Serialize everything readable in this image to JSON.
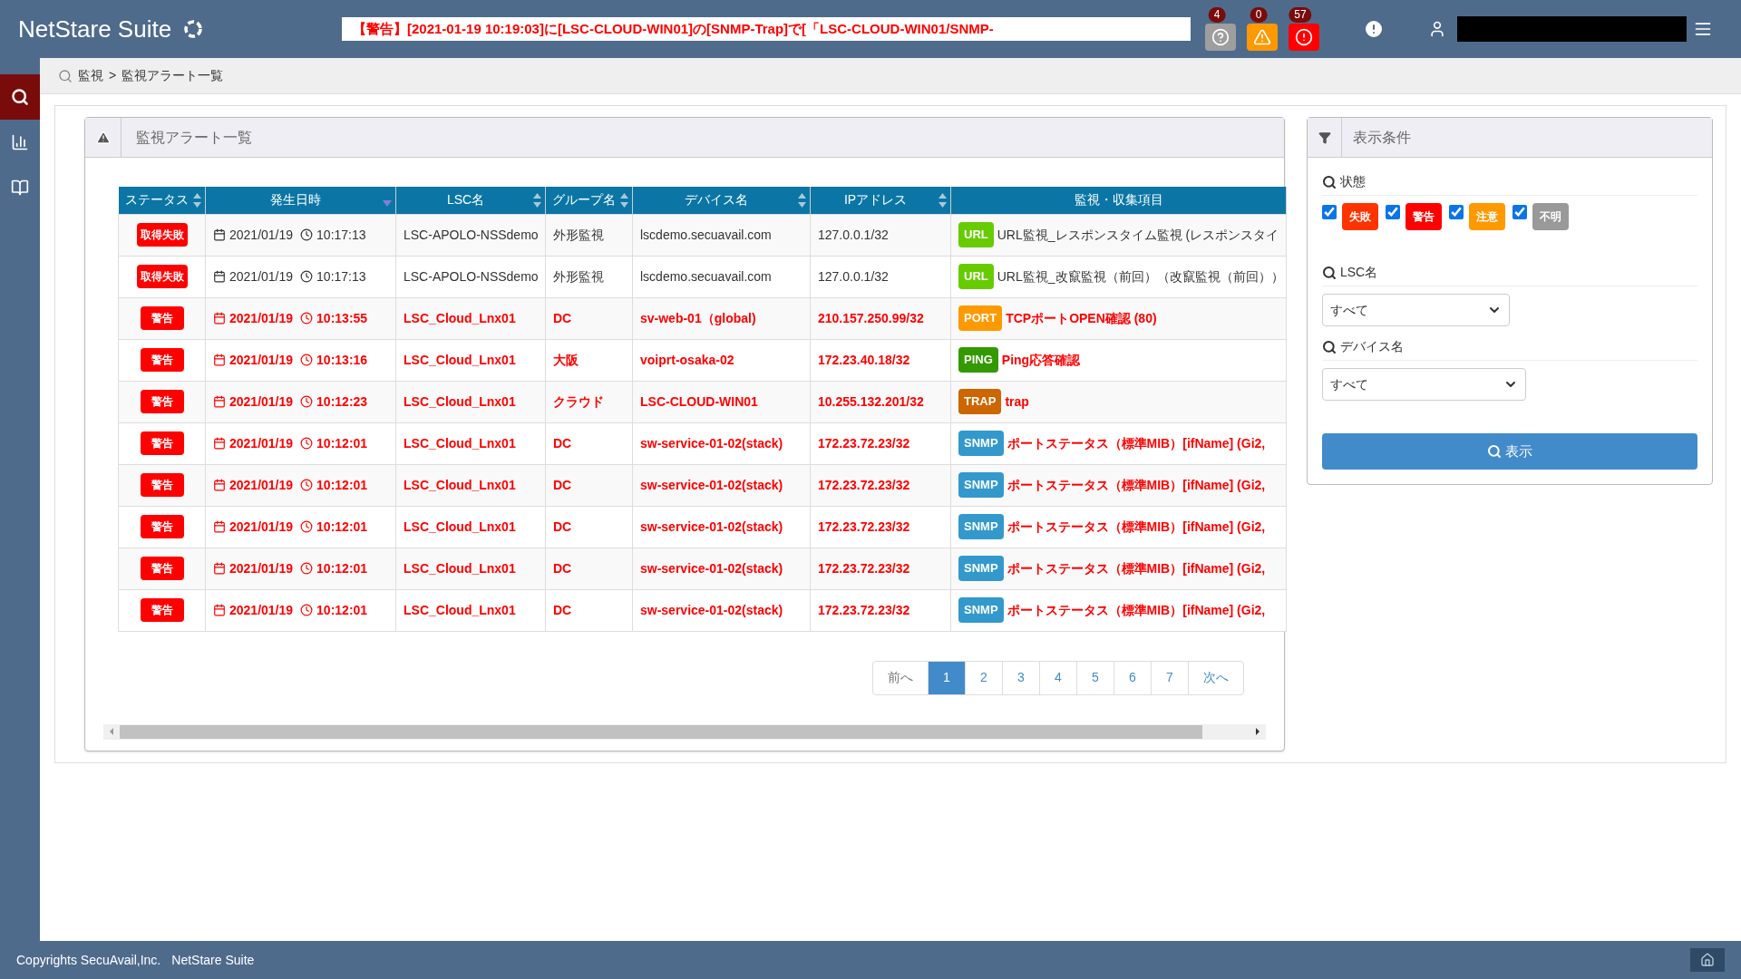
{
  "header": {
    "logo": "NetStare Suite",
    "alert_ticker": "【警告】[2021-01-19 10:19:03]に[LSC-CLOUD-WIN01]の[SNMP-Trap]で[「LSC-CLOUD-WIN01/SNMP-",
    "counters": [
      {
        "kind": "unknown",
        "count": "4"
      },
      {
        "kind": "caution",
        "count": "0"
      },
      {
        "kind": "warning",
        "count": "57"
      }
    ]
  },
  "sidebar": {
    "items": [
      {
        "kind": "search",
        "selected": true
      },
      {
        "kind": "chart",
        "selected": false
      },
      {
        "kind": "book",
        "selected": false
      }
    ]
  },
  "breadcrumb": {
    "items": [
      "監視",
      "監視アラート一覧"
    ],
    "separator": ">"
  },
  "alert_panel": {
    "title": "監視アラート一覧",
    "columns": [
      {
        "label": "ステータス",
        "kind": "sortable"
      },
      {
        "label": "発生日時",
        "kind": "sorted"
      },
      {
        "label": "LSC名",
        "kind": "sortable"
      },
      {
        "label": "グループ名",
        "kind": "sortable"
      },
      {
        "label": "デバイス名",
        "kind": "sortable"
      },
      {
        "label": "IPアドレス",
        "kind": "sortable"
      },
      {
        "label": "監視・収集項目",
        "kind": "plain"
      }
    ],
    "rows": [
      {
        "status": {
          "label": "取得失敗",
          "kind": "failed"
        },
        "date": "2021/01/19",
        "time": "10:17:13",
        "lsc": "LSC-APOLO-NSSdemo",
        "group": "外形監視",
        "device": "lscdemo.secuavail.com",
        "ip": "127.0.0.1/32",
        "item_type": {
          "label": "URL",
          "color": "#66cc00"
        },
        "item": "URL監視_レスポンスタイム監視 (レスポンスタイ"
      },
      {
        "status": {
          "label": "取得失敗",
          "kind": "failed"
        },
        "date": "2021/01/19",
        "time": "10:17:13",
        "lsc": "LSC-APOLO-NSSdemo",
        "group": "外形監視",
        "device": "lscdemo.secuavail.com",
        "ip": "127.0.0.1/32",
        "item_type": {
          "label": "URL",
          "color": "#66cc00"
        },
        "item": "URL監視_改竄監視（前回）（改竄監視（前回））"
      },
      {
        "status": {
          "label": "警告",
          "kind": "warning"
        },
        "date": "2021/01/19",
        "time": "10:13:55",
        "lsc": "LSC_Cloud_Lnx01",
        "group": "DC",
        "device": "sv-web-01（global)",
        "ip": "210.157.250.99/32",
        "item_type": {
          "label": "PORT",
          "color": "#ff9900"
        },
        "item": "TCPポートOPEN確認 (80)"
      },
      {
        "status": {
          "label": "警告",
          "kind": "warning"
        },
        "date": "2021/01/19",
        "time": "10:13:16",
        "lsc": "LSC_Cloud_Lnx01",
        "group": "大阪",
        "device": "voiprt-osaka-02",
        "ip": "172.23.40.18/32",
        "item_type": {
          "label": "PING",
          "color": "#339900"
        },
        "item": "Ping応答確認"
      },
      {
        "status": {
          "label": "警告",
          "kind": "warning"
        },
        "date": "2021/01/19",
        "time": "10:12:23",
        "lsc": "LSC_Cloud_Lnx01",
        "group": "クラウド",
        "device": "LSC-CLOUD-WIN01",
        "ip": "10.255.132.201/32",
        "item_type": {
          "label": "TRAP",
          "color": "#cc6600"
        },
        "item": "trap"
      },
      {
        "status": {
          "label": "警告",
          "kind": "warning"
        },
        "date": "2021/01/19",
        "time": "10:12:01",
        "lsc": "LSC_Cloud_Lnx01",
        "group": "DC",
        "device": "sw-service-01-02(stack)",
        "ip": "172.23.72.23/32",
        "item_type": {
          "label": "SNMP",
          "color": "#3399cc"
        },
        "item": "ポートステータス（標準MIB）[ifName] (Gi2,"
      },
      {
        "status": {
          "label": "警告",
          "kind": "warning"
        },
        "date": "2021/01/19",
        "time": "10:12:01",
        "lsc": "LSC_Cloud_Lnx01",
        "group": "DC",
        "device": "sw-service-01-02(stack)",
        "ip": "172.23.72.23/32",
        "item_type": {
          "label": "SNMP",
          "color": "#3399cc"
        },
        "item": "ポートステータス（標準MIB）[ifName] (Gi2,"
      },
      {
        "status": {
          "label": "警告",
          "kind": "warning"
        },
        "date": "2021/01/19",
        "time": "10:12:01",
        "lsc": "LSC_Cloud_Lnx01",
        "group": "DC",
        "device": "sw-service-01-02(stack)",
        "ip": "172.23.72.23/32",
        "item_type": {
          "label": "SNMP",
          "color": "#3399cc"
        },
        "item": "ポートステータス（標準MIB）[ifName] (Gi2,"
      },
      {
        "status": {
          "label": "警告",
          "kind": "warning"
        },
        "date": "2021/01/19",
        "time": "10:12:01",
        "lsc": "LSC_Cloud_Lnx01",
        "group": "DC",
        "device": "sw-service-01-02(stack)",
        "ip": "172.23.72.23/32",
        "item_type": {
          "label": "SNMP",
          "color": "#3399cc"
        },
        "item": "ポートステータス（標準MIB）[ifName] (Gi2,"
      },
      {
        "status": {
          "label": "警告",
          "kind": "warning"
        },
        "date": "2021/01/19",
        "time": "10:12:01",
        "lsc": "LSC_Cloud_Lnx01",
        "group": "DC",
        "device": "sw-service-01-02(stack)",
        "ip": "172.23.72.23/32",
        "item_type": {
          "label": "SNMP",
          "color": "#3399cc"
        },
        "item": "ポートステータス（標準MIB）[ifName] (Gi2,"
      }
    ],
    "pagination": {
      "prev": "前へ",
      "next": "次へ",
      "pages": [
        {
          "label": "1",
          "selected": true
        },
        {
          "label": "2",
          "selected": false
        },
        {
          "label": "3",
          "selected": false
        },
        {
          "label": "4",
          "selected": false
        },
        {
          "label": "5",
          "selected": false
        },
        {
          "label": "6",
          "selected": false
        },
        {
          "label": "7",
          "selected": false
        }
      ]
    }
  },
  "filter_panel": {
    "title": "表示条件",
    "status_label": "状態",
    "statuses": [
      {
        "label": "失敗",
        "checked": true,
        "color": "#ff3300"
      },
      {
        "label": "警告",
        "checked": true,
        "color": "#ff0000"
      },
      {
        "label": "注意",
        "checked": true,
        "color": "#ff9900"
      },
      {
        "label": "不明",
        "checked": true,
        "color": "#999999"
      }
    ],
    "lsc_label": "LSC名",
    "lsc_value": "すべて",
    "device_label": "デバイス名",
    "device_value": "すべて",
    "submit": "表示"
  },
  "footer": {
    "copyright": "Copyrights SecuAvail,Inc.",
    "product": "NetStare Suite"
  }
}
